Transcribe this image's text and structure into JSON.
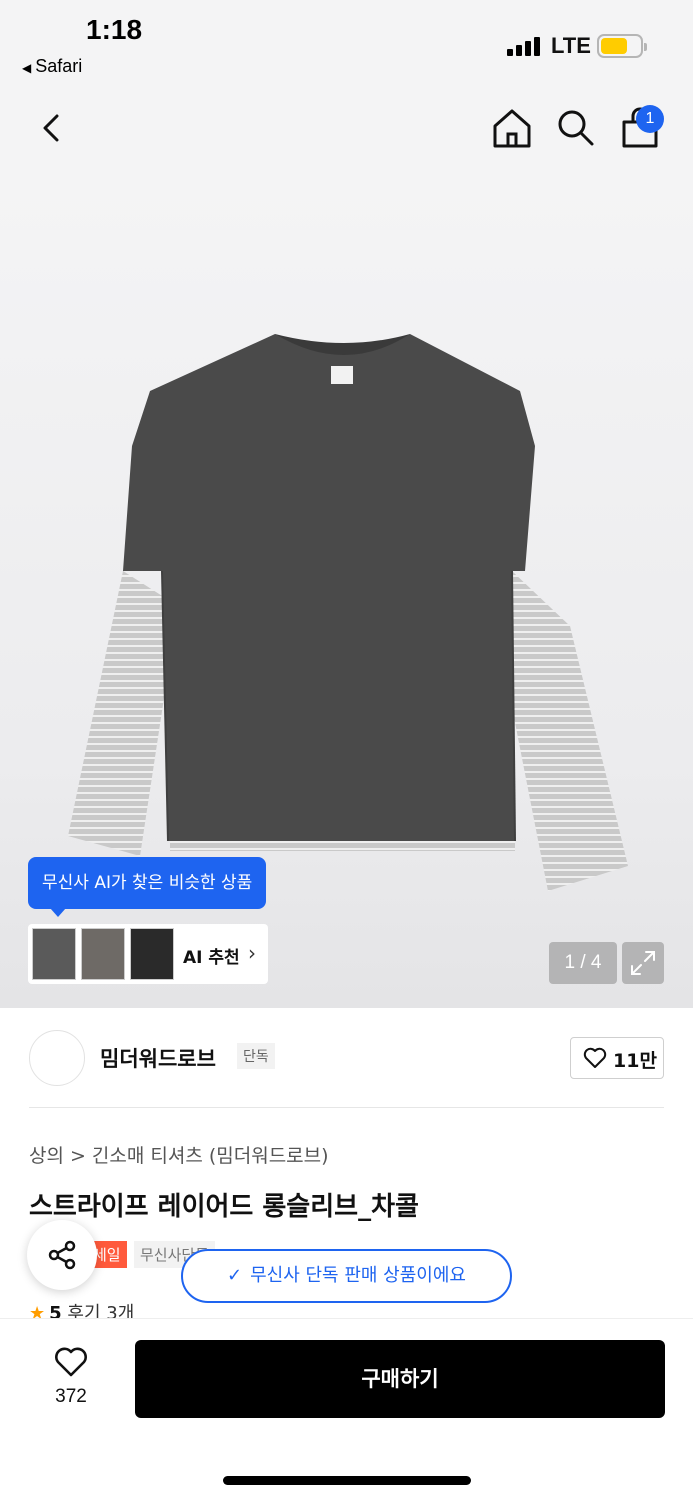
{
  "status_bar": {
    "time": "1:18",
    "back_app": "Safari",
    "network": "LTE",
    "battery_level": 0.65
  },
  "nav": {
    "cart_count": "1"
  },
  "product_image": {
    "ai_tooltip": "무신사 AI가 찾은 비슷한 상품",
    "ai_recommend_label": "AI 추천",
    "pager": "1 / 4"
  },
  "brand": {
    "name": "밈더워드로브",
    "exclusive_badge": "단독",
    "likes": "11만"
  },
  "product": {
    "breadcrumb": [
      "상의",
      ">",
      "긴소매 티셔츠 (밈더워드로브)"
    ],
    "title": "스트라이프 레이어드 롱슬리브_차콜",
    "tags": [
      "세일",
      "무신사단독"
    ],
    "tag_visible": [
      "세일",
      "무신사"
    ],
    "rating": "5",
    "reviews": "후기 3개"
  },
  "toast": {
    "text": "무신사 단독 판매 상품이에요"
  },
  "bottom_bar": {
    "wish_count": "372",
    "buy_label": "구매하기"
  },
  "colors": {
    "accent": "#1e64f0",
    "sale": "#ff5a3c",
    "star": "#ff9d00",
    "buy_button": "#000000"
  },
  "icons": [
    "back-icon",
    "home-icon",
    "search-icon",
    "cart-icon",
    "expand-icon",
    "heart-icon",
    "share-icon",
    "check-icon",
    "star-icon",
    "chevron-right-icon"
  ]
}
